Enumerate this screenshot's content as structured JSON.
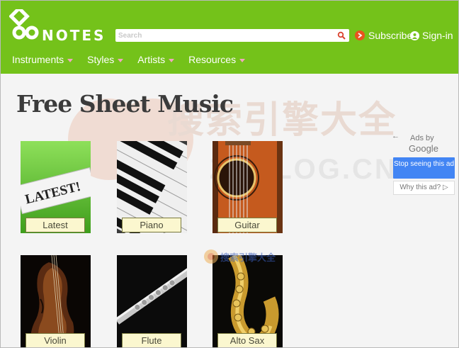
{
  "header": {
    "brand": "NOTES",
    "search_placeholder": "Search",
    "subscribe_label": "Subscribe",
    "signin_label": "Sign-in",
    "nav": [
      {
        "label": "Instruments"
      },
      {
        "label": "Styles"
      },
      {
        "label": "Artists"
      },
      {
        "label": "Resources"
      }
    ]
  },
  "main": {
    "title": "Free Sheet Music",
    "tiles": [
      {
        "label": "Latest",
        "sign_text": "LATEST!"
      },
      {
        "label": "Piano"
      },
      {
        "label": "Guitar"
      },
      {
        "label": "Violin"
      },
      {
        "label": "Flute"
      },
      {
        "label": "Alto Sax"
      }
    ]
  },
  "ads": {
    "ads_by": "Ads by",
    "google": "Google",
    "stop_label": "Stop seeing this ad",
    "why_label": "Why this ad? ▷"
  },
  "watermark": {
    "cn": "搜索引擎大全",
    "en": "ZHBLOG.CN",
    "small": "搜索引擎大全"
  },
  "colors": {
    "header_green": "#74c21a",
    "ad_blue": "#4285f4",
    "label_bg": "#fbf7cf"
  }
}
